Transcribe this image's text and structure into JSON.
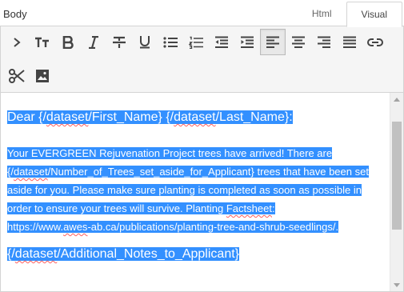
{
  "field": {
    "label": "Body"
  },
  "tabs": [
    {
      "label": "Html",
      "active": false
    },
    {
      "label": "Visual",
      "active": true
    }
  ],
  "toolbar": {
    "row1": [
      "chevron-right-icon",
      "text-size-icon",
      "bold-icon",
      "italic-icon",
      "strikethrough-icon",
      "underline-icon",
      "bulleted-list-icon",
      "numbered-list-icon",
      "outdent-icon",
      "indent-icon",
      "align-left-icon",
      "align-center-icon",
      "align-right-icon",
      "justify-icon",
      "link-icon"
    ],
    "row2": [
      "cut-icon",
      "image-icon"
    ],
    "selected": "align-left-icon"
  },
  "editor": {
    "greeting": {
      "prefix": "Dear {/",
      "w1": "dataset",
      "mid": "/First_Name} {/",
      "w2": "dataset",
      "suffix": "/Last_Name}:"
    },
    "p": {
      "l1": "Your EVERGREEN Rejuvenation Project trees have arrived!  There are",
      "l2a": "{/",
      "l2w": "dataset",
      "l2b": "/Number_of_Trees_set_aside_for_Applicant} trees that have been set",
      "l3": "aside for you.  Please make sure planting is completed as soon as possible in",
      "l4a": "order to ensure your trees will survive.  Planting ",
      "l4w": "Factsheet",
      "l4b": ":",
      "l5a": "https://www.",
      "l5w": "awes",
      "l5b": "-ab.ca/publications/planting-tree-and-shrub-seedlings/."
    },
    "notes": {
      "prefix": "{/",
      "w": "dataset",
      "suffix": "/Additional_Notes_to_Applicant}"
    }
  },
  "colors": {
    "selection": "#3390ff",
    "toolbar_bg": "#f5f5f5",
    "border": "#d4d4d4"
  }
}
